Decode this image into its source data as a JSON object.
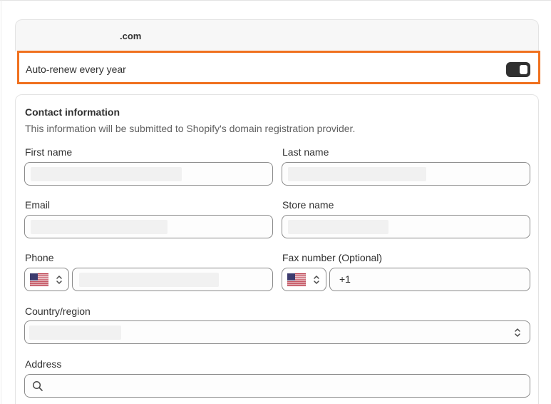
{
  "domain": {
    "name": ".com"
  },
  "auto_renew": {
    "label": "Auto-renew every year",
    "enabled": true
  },
  "contact": {
    "title": "Contact information",
    "subtitle": "This information will be submitted to Shopify's domain registration provider.",
    "first_name_label": "First name",
    "last_name_label": "Last name",
    "email_label": "Email",
    "store_name_label": "Store name",
    "phone_label": "Phone",
    "fax_label": "Fax number (Optional)",
    "fax_prefix": "+1",
    "country_label": "Country/region",
    "address_label": "Address"
  },
  "colors": {
    "highlight": "#f0711f",
    "toggle_on": "#303030"
  },
  "icons": {
    "flag": "us-flag-icon",
    "select": "chevron-up-down-icon",
    "search": "search-icon"
  }
}
